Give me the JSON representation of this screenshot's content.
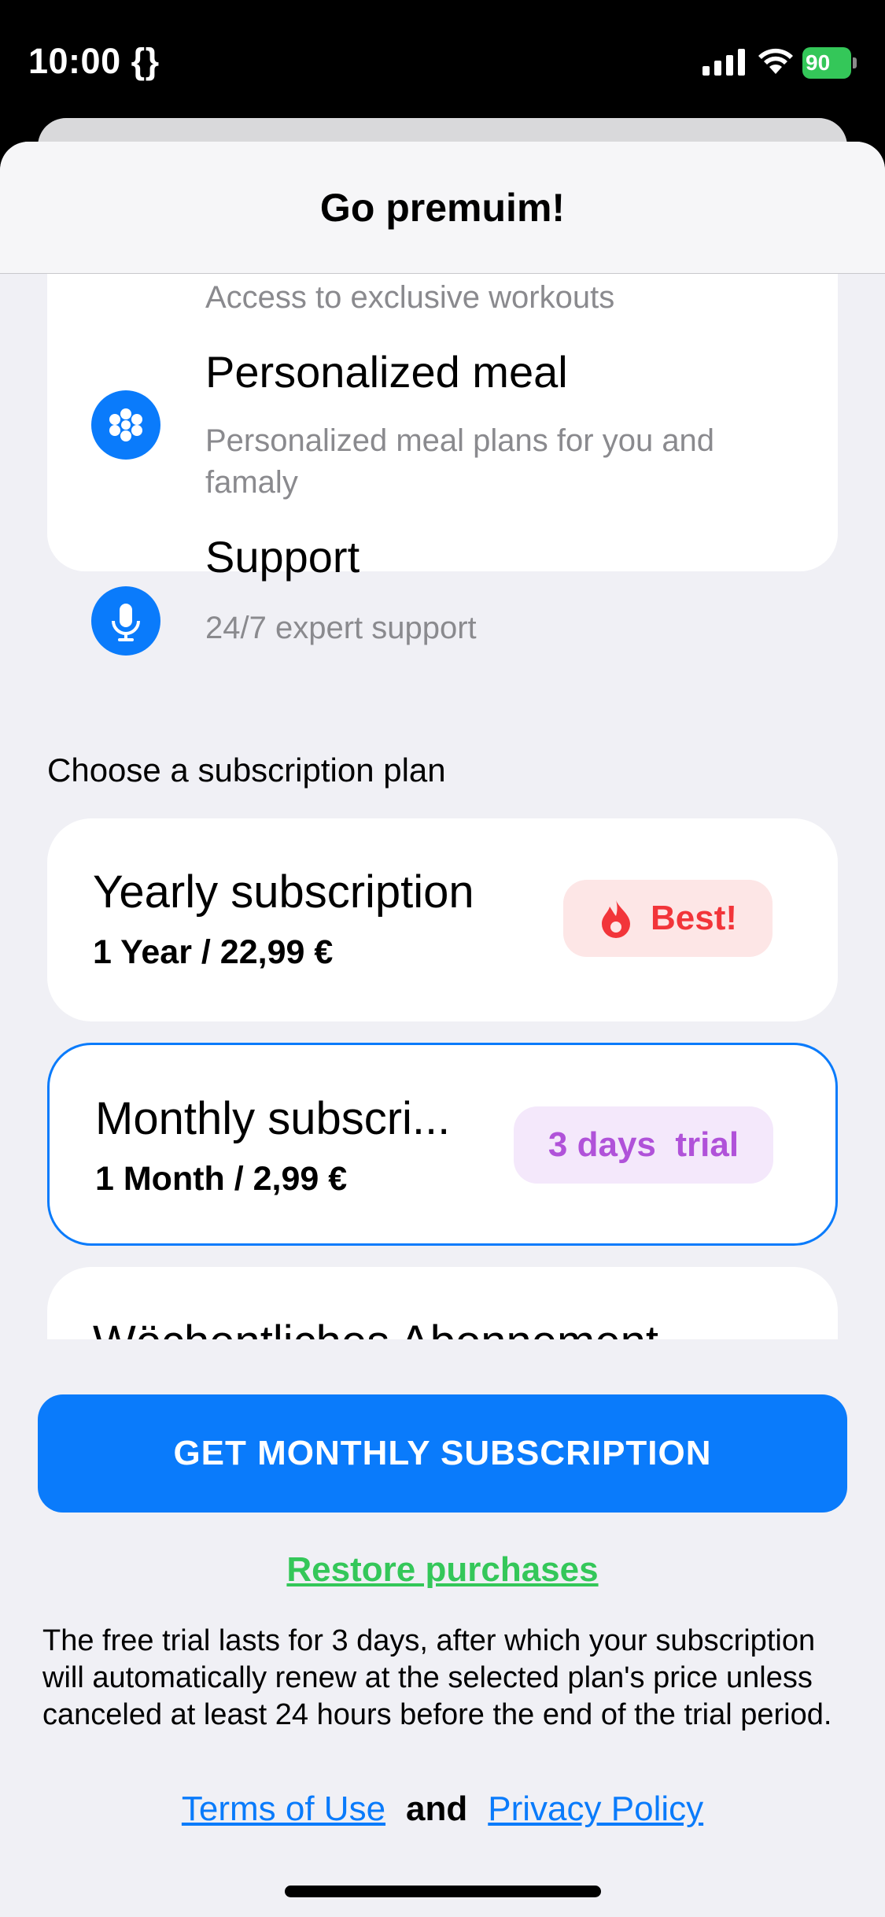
{
  "status_bar": {
    "time": "10:00 {}",
    "battery": "90"
  },
  "sheet": {
    "title": "Go premuim!"
  },
  "features": [
    {
      "icon": "arrow-icon",
      "title": "",
      "description": "Access to exclusive workouts"
    },
    {
      "icon": "flower-icon",
      "title": "Personalized meal",
      "description": "Personalized meal plans for you and famaly"
    },
    {
      "icon": "microphone-icon",
      "title": "Support",
      "description": "24/7 expert support"
    }
  ],
  "plans": {
    "section_label": "Choose a subscription plan",
    "items": [
      {
        "name": "Yearly subscription",
        "price": "1 Year / 22,99 €",
        "badge": "Best!",
        "selected": false
      },
      {
        "name": "Monthly subscri...",
        "price": "1 Month / 2,99 €",
        "badge": "3 days  trial",
        "selected": true
      },
      {
        "name": "Wöchentliches Abonnement",
        "price": "",
        "badge": "",
        "selected": false
      }
    ]
  },
  "bottom": {
    "cta_label": "GET MONTHLY SUBSCRIPTION",
    "restore_label": "Restore purchases",
    "disclaimer": "The free trial lasts for 3 days, after which your subscription will automatically renew at the selected plan's price unless canceled at least 24 hours before the end of the trial period.",
    "terms_label": "Terms of Use",
    "and_label": "and",
    "privacy_label": "Privacy Policy"
  },
  "colors": {
    "accent": "#0a7bfb",
    "restore": "#34c759",
    "best_badge": "#f2353a",
    "trial_badge": "#b052d9"
  }
}
